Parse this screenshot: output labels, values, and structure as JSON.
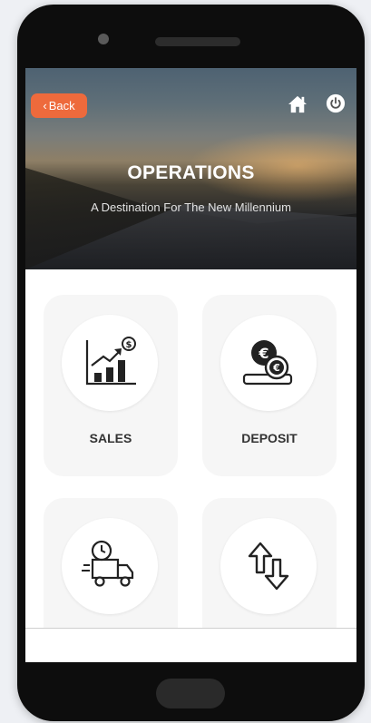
{
  "header": {
    "back_label": "Back",
    "back_chevron": "‹",
    "title": "OPERATIONS",
    "subtitle": "A Destination For The New Millennium",
    "icons": [
      "home-icon",
      "power-icon"
    ]
  },
  "tiles": [
    {
      "label": "SALES",
      "icon": "sales-chart-icon"
    },
    {
      "label": "DEPOSIT",
      "icon": "deposit-coins-icon"
    },
    {
      "label": "",
      "icon": "delivery-truck-icon"
    },
    {
      "label": "",
      "icon": "transfer-arrows-icon"
    }
  ],
  "colors": {
    "accent": "#ee6a3c",
    "icon_dark": "#222222",
    "card_bg": "#f6f6f6"
  }
}
